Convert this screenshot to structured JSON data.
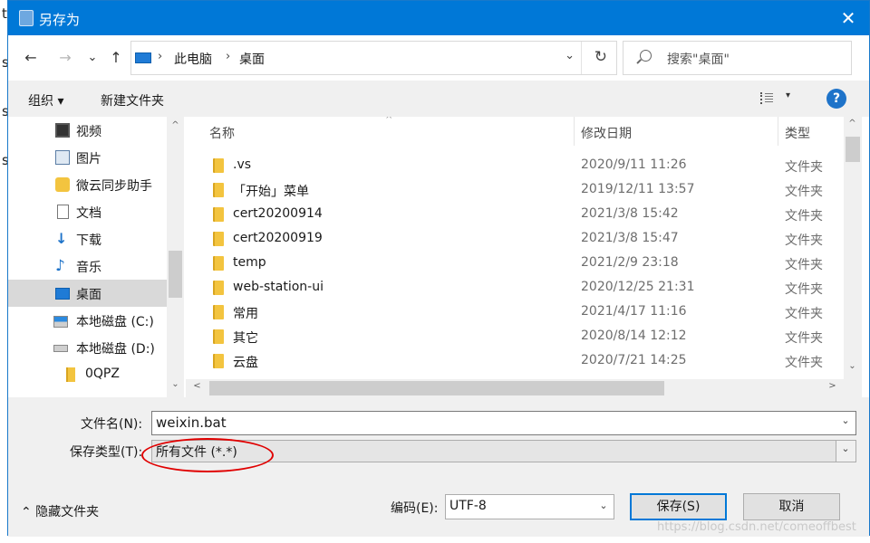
{
  "background_app": {
    "letters": [
      "t",
      "s",
      "s",
      "s"
    ]
  },
  "dialog": {
    "title": "另存为",
    "close_glyph": "✕"
  },
  "nav": {
    "back_glyph": "←",
    "forward_glyph": "→",
    "recent_glyph": "⌄",
    "up_glyph": "↑",
    "address_separator": "›",
    "breadcrumbs": [
      "此电脑",
      "桌面"
    ],
    "dropdown_glyph": "⌄",
    "refresh_glyph": "↻",
    "search_placeholder": "搜索\"桌面\""
  },
  "toolbar": {
    "organize_label": "组织 ▾",
    "new_folder_label": "新建文件夹",
    "view_caret": "▾",
    "help_glyph": "?"
  },
  "sidebar": {
    "items": [
      {
        "label": "视频",
        "icon": "video-icon",
        "selected": false
      },
      {
        "label": "图片",
        "icon": "pictures-icon",
        "selected": false
      },
      {
        "label": "微云同步助手",
        "icon": "weiyun-icon",
        "selected": false
      },
      {
        "label": "文档",
        "icon": "documents-icon",
        "selected": false
      },
      {
        "label": "下载",
        "icon": "download-icon",
        "selected": false
      },
      {
        "label": "音乐",
        "icon": "music-icon",
        "selected": false
      },
      {
        "label": "桌面",
        "icon": "desktop-icon",
        "selected": true
      },
      {
        "label": "本地磁盘 (C:)",
        "icon": "drive-c-icon",
        "selected": false
      },
      {
        "label": "本地磁盘 (D:)",
        "icon": "drive-d-icon",
        "selected": false
      },
      {
        "label": "0QPZ",
        "icon": "folder-icon",
        "selected": false
      }
    ],
    "scroll_up_glyph": "^",
    "scroll_down_glyph": "⌄"
  },
  "file_list": {
    "columns": {
      "name": "名称",
      "date": "修改日期",
      "type": "类型"
    },
    "sort_glyph": "^",
    "rows": [
      {
        "name": ".vs",
        "date": "2020/9/11 11:26",
        "type": "文件夹"
      },
      {
        "name": "「开始」菜单",
        "date": "2019/12/11 13:57",
        "type": "文件夹"
      },
      {
        "name": "cert20200914",
        "date": "2021/3/8 15:42",
        "type": "文件夹"
      },
      {
        "name": "cert20200919",
        "date": "2021/3/8 15:47",
        "type": "文件夹"
      },
      {
        "name": "temp",
        "date": "2021/2/9 23:18",
        "type": "文件夹"
      },
      {
        "name": "web-station-ui",
        "date": "2020/12/25 21:31",
        "type": "文件夹"
      },
      {
        "name": "常用",
        "date": "2021/4/17 11:16",
        "type": "文件夹"
      },
      {
        "name": "其它",
        "date": "2020/8/14 12:12",
        "type": "文件夹"
      },
      {
        "name": "云盘",
        "date": "2020/7/21 14:25",
        "type": "文件夹"
      }
    ],
    "scroll_up_glyph": "^",
    "scroll_down_glyph": "⌄",
    "scroll_left_glyph": "<",
    "scroll_right_glyph": ">"
  },
  "form": {
    "filename_label": "文件名(N):",
    "filename_value": "weixin.bat",
    "type_label": "保存类型(T):",
    "type_value": "所有文件  (*.*)",
    "combo_caret": "⌄",
    "hide_folders_label": "⌃  隐藏文件夹",
    "encoding_label": "编码(E):",
    "encoding_value": "UTF-8",
    "save_label": "保存(S)",
    "cancel_label": "取消"
  },
  "watermark": "https://blog.csdn.net/comeoffbest",
  "colors": {
    "titlebar": "#0078d7",
    "highlight": "#e00000",
    "folder": "#f3c43f"
  }
}
